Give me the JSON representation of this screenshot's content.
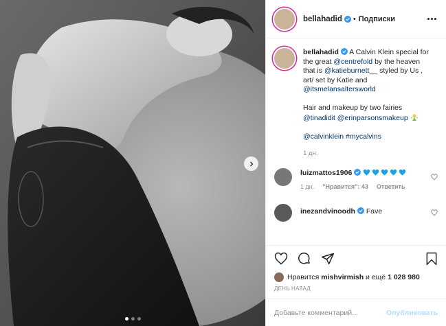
{
  "header": {
    "username": "bellahadid",
    "separator": "•",
    "follow_label": "Подписки"
  },
  "caption": {
    "username": "bellahadid",
    "text_1": "A Calvin Klein special for the great",
    "mention_1": "@centrefold",
    "text_2": "by the heaven that is",
    "mention_2": "@katieburnett__",
    "text_3": "styled by Us , art/ set by Katie and",
    "mention_3": "@itsmelansaltersworld",
    "text_4": "Hair and makeup by two fairies",
    "mention_4": "@tinadidit",
    "mention_5": "@erinparsonsmakeup",
    "emoji_desc": "fairy",
    "tag_1": "@calvinklein",
    "tag_2": "#mycalvins",
    "time": "1 дн."
  },
  "comments": [
    {
      "username": "luizmattos1906",
      "hearts": 5,
      "heart_color": "#18a2e6",
      "time": "1 дн.",
      "likes": "\"Нравится\": 43",
      "reply": "Ответить"
    },
    {
      "username": "inezandvinoodh",
      "text": "Fave"
    }
  ],
  "likes": {
    "prefix": "Нравится",
    "user": "mishvirmish",
    "suffix": "и ещё",
    "count": "1 028 980"
  },
  "date": "ДЕНЬ НАЗАД",
  "comment_box": {
    "placeholder": "Добавьте комментарий...",
    "publish": "Опубликовать"
  },
  "carousel": {
    "slides": 3,
    "active": 0
  },
  "colors": {
    "verified": "#3897f0",
    "link": "#00376b",
    "publish_disabled": "#b2dffc"
  }
}
